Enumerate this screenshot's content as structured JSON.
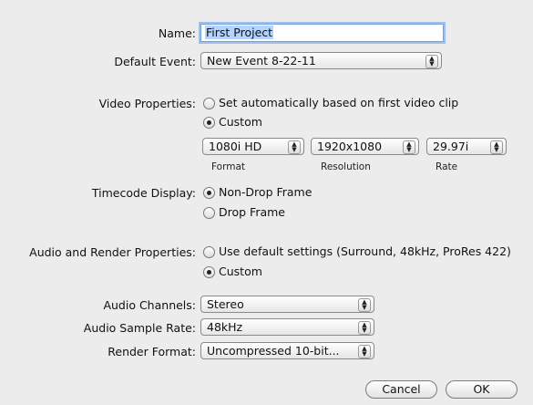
{
  "name": {
    "label": "Name:",
    "value": "First Project"
  },
  "default_event": {
    "label": "Default Event:",
    "value": "New Event 8-22-11"
  },
  "video_properties": {
    "label": "Video Properties:",
    "option_auto": "Set automatically based on first video clip",
    "option_custom": "Custom",
    "selected": "Custom",
    "format": {
      "value": "1080i HD",
      "caption": "Format"
    },
    "resolution": {
      "value": "1920x1080",
      "caption": "Resolution"
    },
    "rate": {
      "value": "29.97i",
      "caption": "Rate"
    }
  },
  "timecode_display": {
    "label": "Timecode Display:",
    "option_non_drop": "Non-Drop Frame",
    "option_drop": "Drop Frame",
    "selected": "Non-Drop Frame"
  },
  "audio_render": {
    "label": "Audio and Render Properties:",
    "option_default": "Use default settings (Surround, 48kHz, ProRes 422)",
    "option_custom": "Custom",
    "selected": "Custom"
  },
  "audio_channels": {
    "label": "Audio Channels:",
    "value": "Stereo"
  },
  "audio_sample_rate": {
    "label": "Audio Sample Rate:",
    "value": "48kHz"
  },
  "render_format": {
    "label": "Render Format:",
    "value": "Uncompressed 10-bit..."
  },
  "buttons": {
    "cancel": "Cancel",
    "ok": "OK"
  },
  "icons": {
    "popup_arrows": "up-down-arrows-icon"
  }
}
